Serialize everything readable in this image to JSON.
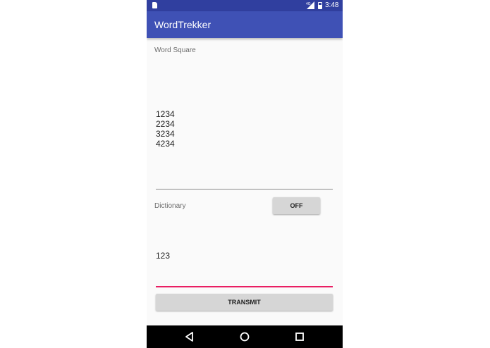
{
  "status_bar": {
    "time": "3:48",
    "network": "4G"
  },
  "app_bar": {
    "title": "WordTrekker"
  },
  "word_square": {
    "label": "Word Square",
    "value": "1234\n2234\n3234\n4234"
  },
  "dictionary": {
    "label": "Dictionary",
    "toggle_label": "OFF",
    "value": "123"
  },
  "transmit_button": {
    "label": "TRANSMIT"
  },
  "nav": {
    "back_icon": "back-triangle",
    "home_icon": "home-circle",
    "recents_icon": "recents-square"
  },
  "colors": {
    "status_bar": "#303f9f",
    "app_bar": "#3f51b5",
    "accent_underline": "#e91e63",
    "button": "#d6d6d6",
    "nav_bar": "#000000"
  }
}
